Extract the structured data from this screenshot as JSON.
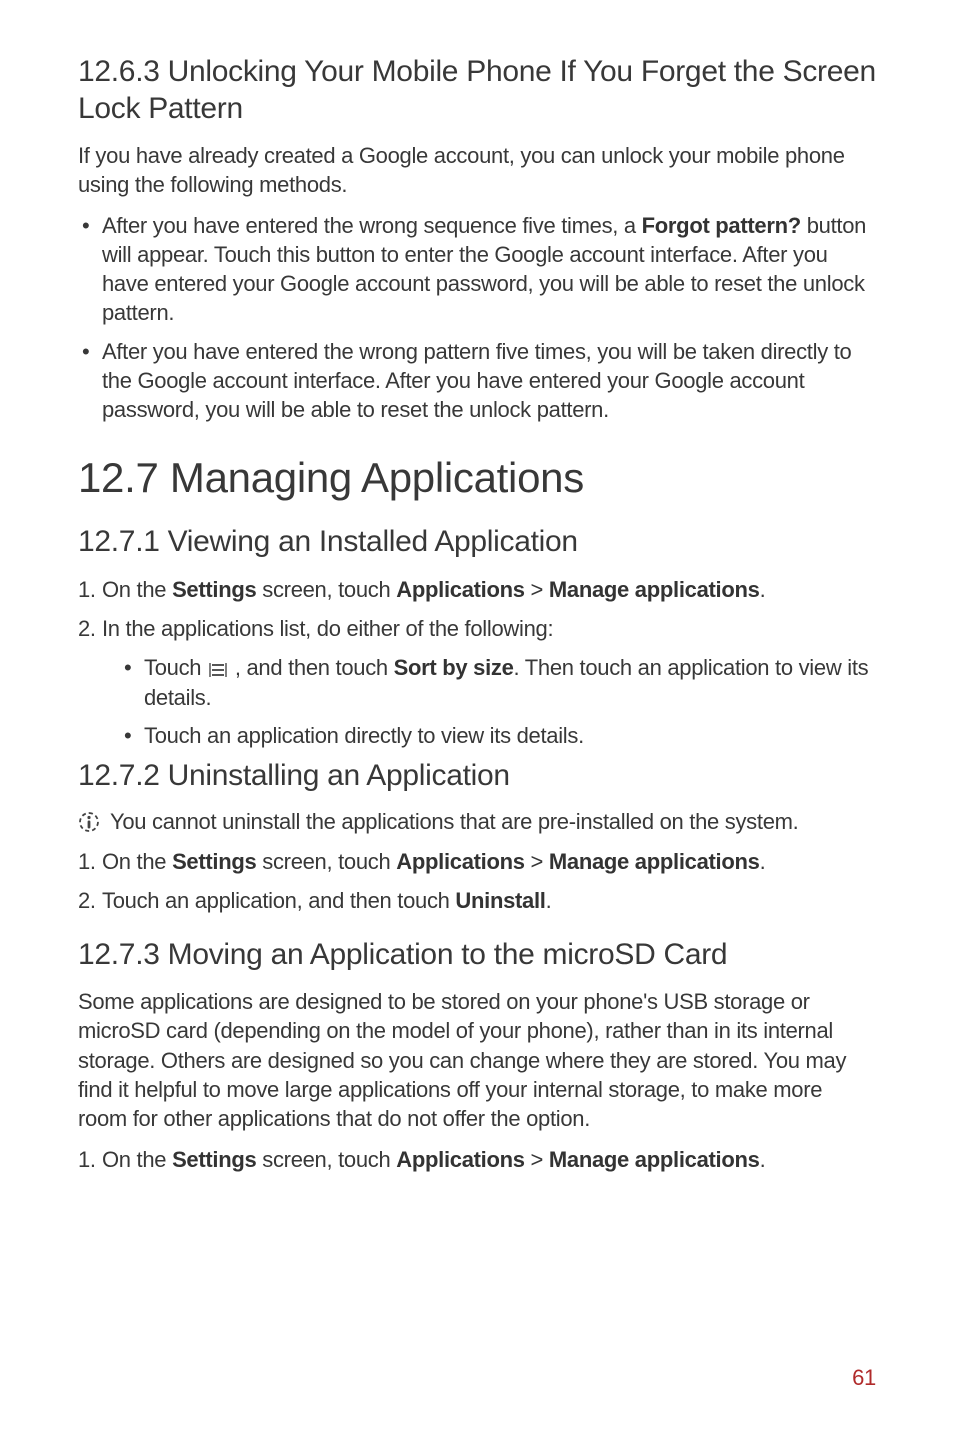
{
  "section_12_6_3": {
    "heading": "12.6.3  Unlocking Your Mobile Phone If You Forget the Screen Lock Pattern",
    "intro": "If you have already created a Google account, you can unlock your mobile phone using the following methods.",
    "bullets": [
      {
        "pre": "After you have entered the wrong sequence five times, a ",
        "bold": "Forgot pattern?",
        "post": " button will appear. Touch this button to enter the Google account interface. After you have entered your Google account password, you will be able to reset the unlock pattern."
      },
      {
        "pre": "After you have entered the wrong pattern five times, you will be taken directly to the Google account interface. After you have entered your Google account password, you will be able to reset the unlock pattern.",
        "bold": "",
        "post": ""
      }
    ]
  },
  "section_12_7": {
    "heading": "12.7  Managing Applications"
  },
  "section_12_7_1": {
    "heading": "12.7.1  Viewing an Installed Application",
    "step1": {
      "num": "1.",
      "t1": "On the ",
      "b1": "Settings",
      "t2": " screen, touch ",
      "b2": "Applications",
      "t3": " > ",
      "b3": "Manage applications",
      "t4": "."
    },
    "step2": {
      "num": "2.",
      "text": "In the applications list, do either of the following:"
    },
    "sub": [
      {
        "pre": "Touch  ",
        "mid": " , and then touch ",
        "bold": "Sort by size",
        "post": ". Then touch an application to view its details."
      },
      {
        "text": "Touch an application directly to view its details."
      }
    ]
  },
  "section_12_7_2": {
    "heading": "12.7.2  Uninstalling an Application",
    "note": "You cannot uninstall the applications that are pre-installed on the system.",
    "step1": {
      "num": "1.",
      "t1": "On the ",
      "b1": "Settings",
      "t2": " screen, touch ",
      "b2": "Applications",
      "t3": " > ",
      "b3": "Manage applications",
      "t4": "."
    },
    "step2": {
      "num": "2.",
      "t1": "Touch an application, and then touch ",
      "b1": "Uninstall",
      "t2": "."
    }
  },
  "section_12_7_3": {
    "heading": "12.7.3  Moving an Application to the microSD Card",
    "intro": "Some applications are designed to be stored on your phone's USB storage or microSD card (depending on the model of your phone), rather than in its internal storage. Others are designed so you can change where they are stored. You may find it helpful to move large applications off your internal storage, to make more room for other applications that do not offer the option.",
    "step1": {
      "num": "1.",
      "t1": "On the ",
      "b1": "Settings",
      "t2": " screen, touch ",
      "b2": "Applications",
      "t3": " > ",
      "b3": "Manage applications",
      "t4": "."
    }
  },
  "page_number": "61"
}
